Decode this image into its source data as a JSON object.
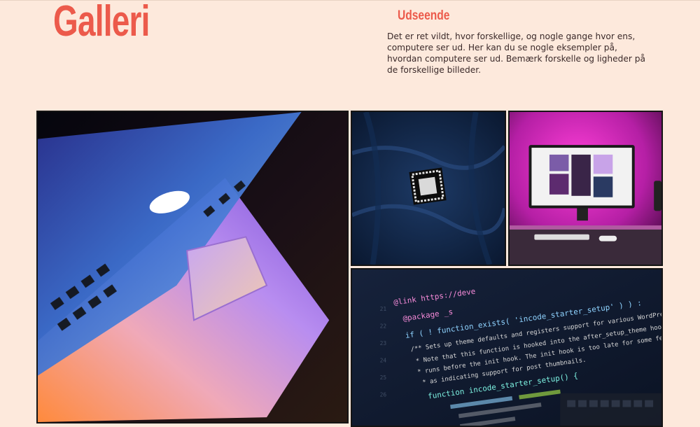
{
  "page": {
    "title": "Galleri"
  },
  "intro": {
    "heading": "Udseende",
    "text": "Det er ret vildt, hvor forskellige, og nogle gange hvor ens, computere ser ud. Her kan du se nogle eksempler på, hvordan computere ser ud. Bemærk forskelle og ligheder på de forskellige billeder."
  },
  "gallery": {
    "code_lines": [
      "@link https://deve",
      "@package _s",
      "if ( ! function_exists( 'incode_starter_setup' ) ) :",
      "/** Sets up theme defaults and registers support for various WordPress",
      " * Note that this function is hooked into the after_setup_theme hook, which",
      " * runs before the init hook. The init hook is too late for some features,",
      " * as indicating support for post thumbnails.",
      "function incode_starter_setup() {"
    ]
  },
  "colors": {
    "background": "#fde9dc",
    "accent": "#ec5a4b",
    "text": "#3b2a2a"
  }
}
